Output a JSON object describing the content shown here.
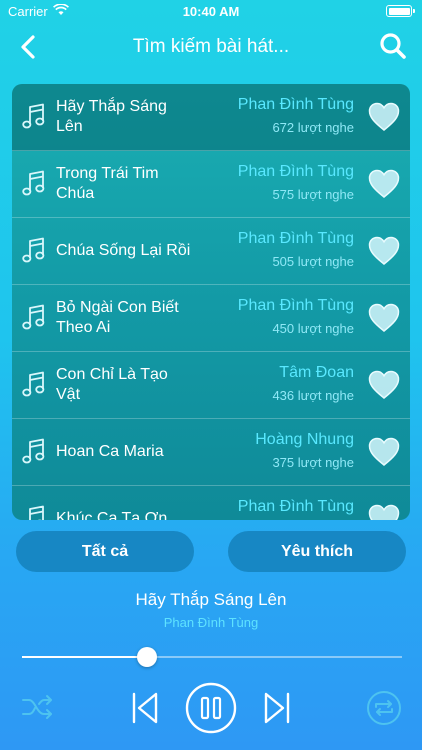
{
  "status_bar": {
    "carrier": "Carrier",
    "time": "10:40 AM"
  },
  "nav": {
    "title": "Tìm kiếm bài hát...",
    "back_icon": "chevron-left-icon",
    "search_icon": "search-icon"
  },
  "songs": [
    {
      "title": "Hãy Thắp Sáng Lên",
      "artist": "Phan Đình Tùng",
      "plays": "672 lượt nghe",
      "active": true
    },
    {
      "title": "Trong Trái Tim Chúa",
      "artist": "Phan Đình Tùng",
      "plays": "575 lượt nghe"
    },
    {
      "title": "Chúa Sống Lại Rồi",
      "artist": "Phan Đình Tùng",
      "plays": "505 lượt nghe"
    },
    {
      "title": "Bỏ Ngài Con Biết Theo Ai",
      "artist": "Phan Đình Tùng",
      "plays": "450 lượt nghe"
    },
    {
      "title": "Con Chỉ Là Tạo Vật",
      "artist": "Tâm Đoan",
      "plays": "436 lượt nghe"
    },
    {
      "title": "Hoan Ca Maria",
      "artist": "Hoàng Nhung",
      "plays": "375 lượt nghe"
    },
    {
      "title": "Khúc Ca Tạ Ơn",
      "artist": "Phan Đình Tùng",
      "plays": ""
    }
  ],
  "tabs": {
    "all_label": "Tất cả",
    "favorites_label": "Yêu thích"
  },
  "now_playing": {
    "title": "Hãy Thắp Sáng Lên",
    "artist": "Phan Đình Tùng",
    "progress": 0.33
  },
  "colors": {
    "accent": "#59e8ff",
    "tab_bg": "#1787c4",
    "list_bg": "#139aa6"
  }
}
